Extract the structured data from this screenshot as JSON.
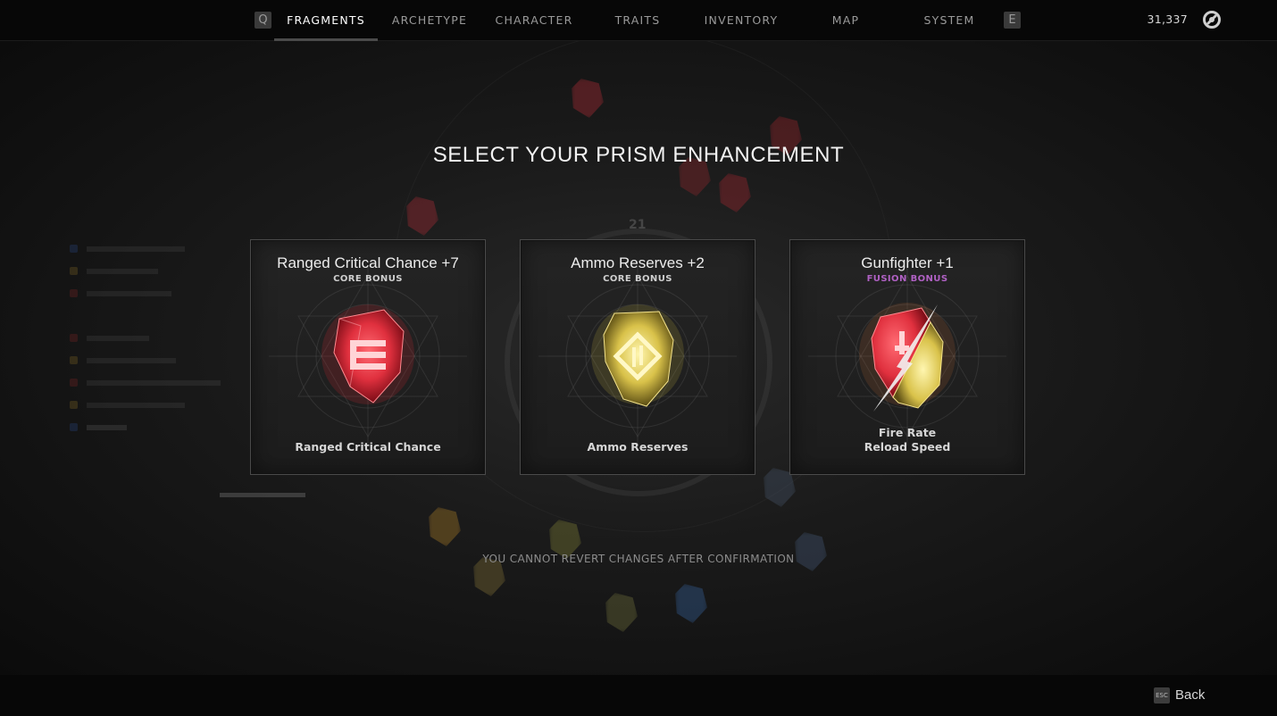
{
  "nav": {
    "left_key": "Q",
    "right_key": "E",
    "tabs": [
      {
        "label": "FRAGMENTS",
        "active": true
      },
      {
        "label": "ARCHETYPE",
        "active": false
      },
      {
        "label": "CHARACTER",
        "active": false
      },
      {
        "label": "TRAITS",
        "active": false
      },
      {
        "label": "INVENTORY",
        "active": false
      },
      {
        "label": "MAP",
        "active": false
      },
      {
        "label": "SYSTEM",
        "active": false
      }
    ],
    "currency": {
      "amount": "31,337",
      "icon": "scrap-currency-icon"
    }
  },
  "background": {
    "faded_number": "21"
  },
  "heading": "SELECT YOUR PRISM ENHANCEMENT",
  "cards": [
    {
      "title": "Ranged Critical Chance +7",
      "bonus_type": "CORE BONUS",
      "gem": "red-fragment-icon",
      "stats": [
        "Ranged Critical Chance"
      ]
    },
    {
      "title": "Ammo Reserves +2",
      "bonus_type": "CORE BONUS",
      "gem": "yellow-fragment-icon",
      "stats": [
        "Ammo Reserves"
      ]
    },
    {
      "title": "Gunfighter +1",
      "bonus_type": "FUSION BONUS",
      "gem": "fusion-fragment-icon",
      "stats": [
        "Fire Rate",
        "Reload Speed"
      ]
    }
  ],
  "warning": "YOU CANNOT REVERT CHANGES AFTER CONFIRMATION",
  "footer": {
    "esc_key": "ESC",
    "back_label": "Back"
  },
  "colors": {
    "red_gem": "#e0303e",
    "yellow_gem": "#d9c24a",
    "fusion_label": "#b061c4"
  }
}
